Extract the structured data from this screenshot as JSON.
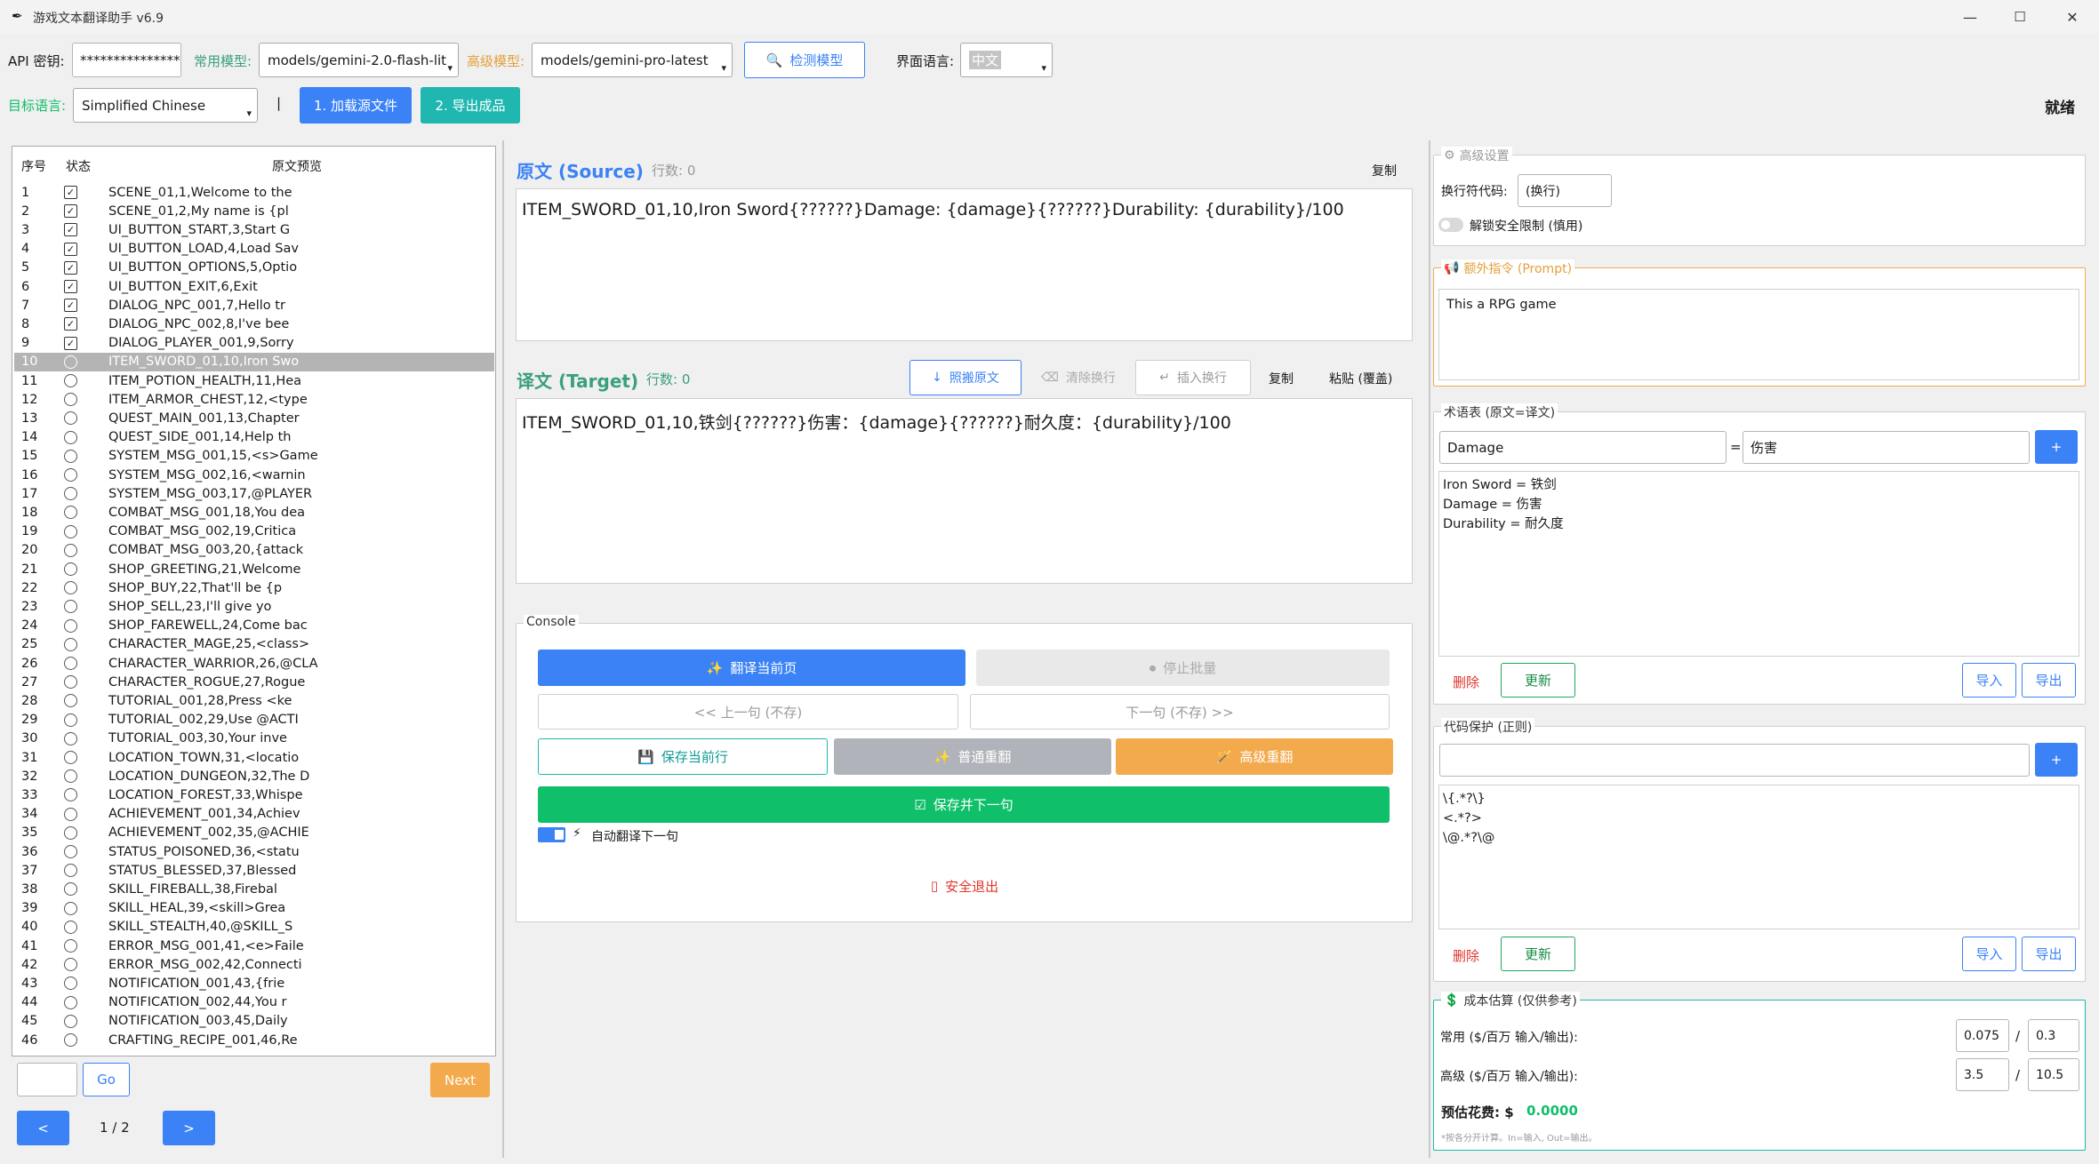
{
  "window": {
    "title": "游戏文本翻译助手 v6.9",
    "min": "—",
    "max": "☐",
    "close": "✕"
  },
  "toolbar": {
    "api_label": "API 密钥:",
    "api_value": "****************",
    "common_model_label": "常用模型:",
    "common_model_value": "models/gemini-2.0-flash-lit",
    "advanced_model_label": "高级模型:",
    "advanced_model_value": "models/gemini-pro-latest",
    "detect_button": "检测模型",
    "ui_lang_label": "界面语言:",
    "ui_lang_value": "中文",
    "target_lang_label": "目标语言:",
    "target_lang_value": "Simplified Chinese",
    "divider": "|",
    "load_button": "1. 加载源文件",
    "export_button": "2. 导出成品",
    "status": "就绪"
  },
  "list": {
    "headers": {
      "num": "序号",
      "status": "状态",
      "preview": "原文预览"
    },
    "rows": [
      {
        "n": "1",
        "done": true,
        "p": "SCENE_01,1,Welcome to the"
      },
      {
        "n": "2",
        "done": true,
        "p": "SCENE_01,2,My name is {pl"
      },
      {
        "n": "3",
        "done": true,
        "p": "UI_BUTTON_START,3,Start G"
      },
      {
        "n": "4",
        "done": true,
        "p": "UI_BUTTON_LOAD,4,Load Sav"
      },
      {
        "n": "5",
        "done": true,
        "p": "UI_BUTTON_OPTIONS,5,Optio"
      },
      {
        "n": "6",
        "done": true,
        "p": "UI_BUTTON_EXIT,6,Exit"
      },
      {
        "n": "7",
        "done": true,
        "p": "DIALOG_NPC_001,7,Hello tr"
      },
      {
        "n": "8",
        "done": true,
        "p": "DIALOG_NPC_002,8,I've bee"
      },
      {
        "n": "9",
        "done": true,
        "p": "DIALOG_PLAYER_001,9,Sorry"
      },
      {
        "n": "10",
        "done": false,
        "sel": true,
        "p": "ITEM_SWORD_01,10,Iron Swo"
      },
      {
        "n": "11",
        "done": false,
        "p": "ITEM_POTION_HEALTH,11,Hea"
      },
      {
        "n": "12",
        "done": false,
        "p": "ITEM_ARMOR_CHEST,12,<type"
      },
      {
        "n": "13",
        "done": false,
        "p": "QUEST_MAIN_001,13,Chapter"
      },
      {
        "n": "14",
        "done": false,
        "p": "QUEST_SIDE_001,14,Help th"
      },
      {
        "n": "15",
        "done": false,
        "p": "SYSTEM_MSG_001,15,<s>Game"
      },
      {
        "n": "16",
        "done": false,
        "p": "SYSTEM_MSG_002,16,<warnin"
      },
      {
        "n": "17",
        "done": false,
        "p": "SYSTEM_MSG_003,17,@PLAYER"
      },
      {
        "n": "18",
        "done": false,
        "p": "COMBAT_MSG_001,18,You dea"
      },
      {
        "n": "19",
        "done": false,
        "p": "COMBAT_MSG_002,19,Critica"
      },
      {
        "n": "20",
        "done": false,
        "p": "COMBAT_MSG_003,20,{attack"
      },
      {
        "n": "21",
        "done": false,
        "p": "SHOP_GREETING,21,Welcome"
      },
      {
        "n": "22",
        "done": false,
        "p": "SHOP_BUY,22,That'll be {p"
      },
      {
        "n": "23",
        "done": false,
        "p": "SHOP_SELL,23,I'll give yo"
      },
      {
        "n": "24",
        "done": false,
        "p": "SHOP_FAREWELL,24,Come bac"
      },
      {
        "n": "25",
        "done": false,
        "p": "CHARACTER_MAGE,25,<class>"
      },
      {
        "n": "26",
        "done": false,
        "p": "CHARACTER_WARRIOR,26,@CLA"
      },
      {
        "n": "27",
        "done": false,
        "p": "CHARACTER_ROGUE,27,Rogue"
      },
      {
        "n": "28",
        "done": false,
        "p": "TUTORIAL_001,28,Press <ke"
      },
      {
        "n": "29",
        "done": false,
        "p": "TUTORIAL_002,29,Use @ACTI"
      },
      {
        "n": "30",
        "done": false,
        "p": "TUTORIAL_003,30,Your inve"
      },
      {
        "n": "31",
        "done": false,
        "p": "LOCATION_TOWN,31,<locatio"
      },
      {
        "n": "32",
        "done": false,
        "p": "LOCATION_DUNGEON,32,The D"
      },
      {
        "n": "33",
        "done": false,
        "p": "LOCATION_FOREST,33,Whispe"
      },
      {
        "n": "34",
        "done": false,
        "p": "ACHIEVEMENT_001,34,Achiev"
      },
      {
        "n": "35",
        "done": false,
        "p": "ACHIEVEMENT_002,35,@ACHIE"
      },
      {
        "n": "36",
        "done": false,
        "p": "STATUS_POISONED,36,<statu"
      },
      {
        "n": "37",
        "done": false,
        "p": "STATUS_BLESSED,37,Blessed"
      },
      {
        "n": "38",
        "done": false,
        "p": "SKILL_FIREBALL,38,Firebal"
      },
      {
        "n": "39",
        "done": false,
        "p": "SKILL_HEAL,39,<skill>Grea"
      },
      {
        "n": "40",
        "done": false,
        "p": "SKILL_STEALTH,40,@SKILL_S"
      },
      {
        "n": "41",
        "done": false,
        "p": "ERROR_MSG_001,41,<e>Faile"
      },
      {
        "n": "42",
        "done": false,
        "p": "ERROR_MSG_002,42,Connecti"
      },
      {
        "n": "43",
        "done": false,
        "p": "NOTIFICATION_001,43,{frie"
      },
      {
        "n": "44",
        "done": false,
        "p": "NOTIFICATION_002,44,You r"
      },
      {
        "n": "45",
        "done": false,
        "p": "NOTIFICATION_003,45,Daily"
      },
      {
        "n": "46",
        "done": false,
        "p": "CRAFTING_RECIPE_001,46,Re"
      }
    ],
    "go_button": "Go",
    "next_button": "Next",
    "prev_page": "<",
    "next_page": ">",
    "page_info": "1 / 2",
    "goto_value": ""
  },
  "source": {
    "title": "原文 (Source)",
    "lines": "行数: 0",
    "copy": "复制",
    "text": "ITEM_SWORD_01,10,Iron Sword{??????}Damage: {damage}{??????}Durability: {durability}/100"
  },
  "target": {
    "title": "译文 (Target)",
    "lines": "行数: 0",
    "copy_src": "照搬原文",
    "clear_nl": "清除换行",
    "insert_nl": "插入换行",
    "copy": "复制",
    "paste": "粘贴 (覆盖)",
    "text": "ITEM_SWORD_01,10,铁剑{??????}伤害：{damage}{??????}耐久度：{durability}/100"
  },
  "console": {
    "title": "Console",
    "translate_page": "翻译当前页",
    "stop_batch": "停止批量",
    "prev": "<< 上一句 (不存)",
    "next": "下一句 (不存) >>",
    "save_row": "保存当前行",
    "normal_retranslate": "普通重翻",
    "advanced_retranslate": "高级重翻",
    "save_next": "保存并下一句",
    "auto_translate": "自动翻译下一句",
    "safe_exit": "安全退出"
  },
  "advanced": {
    "title": "高级设置",
    "nl_label": "换行符代码:",
    "nl_value": "(换行)",
    "unlock_label": "解锁安全限制 (慎用)"
  },
  "prompt": {
    "title": "额外指令 (Prompt)",
    "text": "This a RPG game"
  },
  "glossary": {
    "title": "术语表 (原文=译文)",
    "src_value": "Damage",
    "eq": "=",
    "dst_value": "伤害",
    "add": "+",
    "entries": "Iron Sword = 铁剑\nDamage = 伤害\nDurability = 耐久度",
    "delete": "删除",
    "update": "更新",
    "import": "导入",
    "export": "导出"
  },
  "protect": {
    "title": "代码保护 (正则)",
    "input_value": "",
    "add": "+",
    "entries": "\\{.*?\\}\n<.*?>\n\\@.*?\\@",
    "delete": "删除",
    "update": "更新",
    "import": "导入",
    "export": "导出"
  },
  "cost": {
    "title": "成本估算 (仅供参考)",
    "common_label": "常用 ($/百万 输入/输出):",
    "common_in": "0.075",
    "common_out": "0.3",
    "adv_label": "高级 ($/百万 输入/输出):",
    "adv_in": "3.5",
    "adv_out": "10.5",
    "slash": "/",
    "est_label": "预估花费: $ ",
    "est_value": "0.0000",
    "note": "*按各分开计算。In=输入, Out=输出。"
  },
  "colors": {
    "blue": "#3b82f6",
    "teal": "#1fb7b0",
    "green": "#0fbf6a",
    "orange": "#f2aa4c",
    "gray": "#b0b4ba",
    "accent_text": "#3aa07a"
  }
}
